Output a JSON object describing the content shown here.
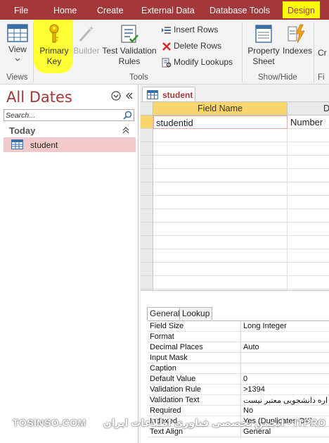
{
  "menubar": {
    "tabs": [
      "File",
      "Home",
      "Create",
      "External Data",
      "Database Tools",
      "Design"
    ],
    "active": "Design",
    "bg_color": "#a4373a",
    "highlight_color": "#ffff00"
  },
  "ribbon": {
    "view": {
      "label": "View",
      "icon": "datasheet-view-icon"
    },
    "primary_key": {
      "line1": "Primary",
      "line2": "Key",
      "icon": "key-icon"
    },
    "builder": {
      "label": "Builder",
      "icon": "magic-wand-icon",
      "disabled": true
    },
    "test_validation": {
      "line1": "Test Validation",
      "line2": "Rules",
      "icon": "validation-rules-icon"
    },
    "insert_rows": {
      "label": "Insert Rows",
      "icon": "insert-rows-icon"
    },
    "delete_rows": {
      "label": "Delete Rows",
      "icon": "delete-rows-icon"
    },
    "modify_lookups": {
      "label": "Modify Lookups",
      "icon": "lookup-icon"
    },
    "property_sheet": {
      "line1": "Property",
      "line2": "Sheet",
      "icon": "property-sheet-icon"
    },
    "indexes": {
      "label": "Indexes",
      "icon": "lightning-icon"
    },
    "clipped_next": "Cr",
    "groups": {
      "views": "Views",
      "tools": "Tools",
      "show_hide": "Show/Hide",
      "clipped_group": "Fi"
    }
  },
  "nav": {
    "title": "All Dates",
    "search_placeholder": "Search...",
    "group": "Today",
    "items": [
      {
        "label": "student",
        "icon": "table-icon"
      }
    ]
  },
  "document": {
    "tab_label": "student",
    "columns": {
      "field_name": "Field Name",
      "data_type": "D"
    },
    "rows": [
      {
        "field": "studentid",
        "type": "Number"
      }
    ],
    "empty_row_count": 13
  },
  "properties": {
    "tabs": [
      "General",
      "Lookup"
    ],
    "active_tab": "General",
    "rows": [
      {
        "label": "Field Size",
        "value": "Long Integer"
      },
      {
        "label": "Format",
        "value": ""
      },
      {
        "label": "Decimal Places",
        "value": "Auto"
      },
      {
        "label": "Input Mask",
        "value": ""
      },
      {
        "label": "Caption",
        "value": ""
      },
      {
        "label": "Default Value",
        "value": "0"
      },
      {
        "label": "Validation Rule",
        "value": ">1394"
      },
      {
        "label": "Validation Text",
        "value": "اره دانشجویی معتبر نیست"
      },
      {
        "label": "Required",
        "value": "No"
      },
      {
        "label": "Indexed",
        "value": "Yes (Duplicates OK)"
      },
      {
        "label": "Text Align",
        "value": "General"
      }
    ]
  },
  "watermark": {
    "logo": "TOSINSO.COM",
    "text": "ITPRO - انجمن تخصصی فناوری اطلاعات ایران"
  }
}
